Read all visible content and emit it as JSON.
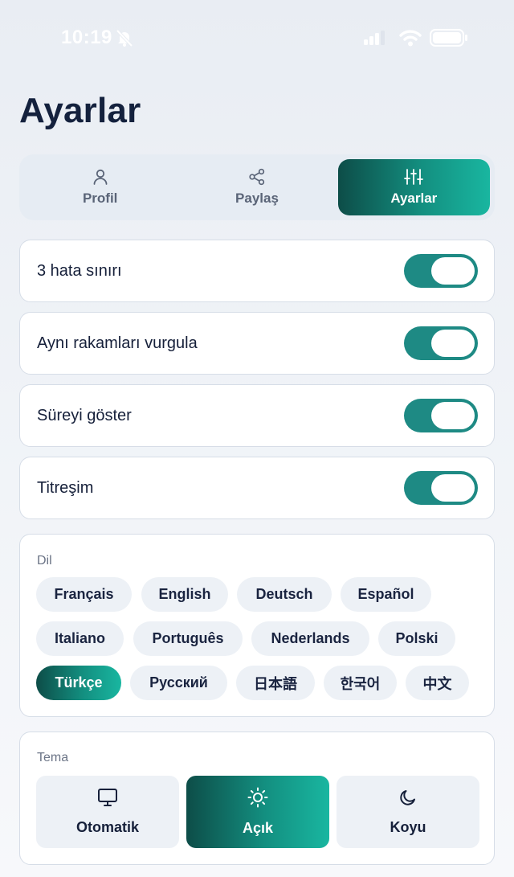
{
  "status_bar": {
    "time": "10:19"
  },
  "page": {
    "title": "Ayarlar"
  },
  "tabs": [
    {
      "label": "Profil",
      "icon": "user-icon",
      "active": false
    },
    {
      "label": "Paylaş",
      "icon": "share-icon",
      "active": false
    },
    {
      "label": "Ayarlar",
      "icon": "sliders-icon",
      "active": true
    }
  ],
  "toggles": [
    {
      "label": "3 hata sınırı",
      "on": true
    },
    {
      "label": "Aynı rakamları vurgula",
      "on": true
    },
    {
      "label": "Süreyi göster",
      "on": true
    },
    {
      "label": "Titreşim",
      "on": true
    }
  ],
  "language": {
    "label": "Dil",
    "selected": "Türkçe",
    "options": [
      "Français",
      "English",
      "Deutsch",
      "Español",
      "Italiano",
      "Português",
      "Nederlands",
      "Polski",
      "Türkçe",
      "Русский",
      "日本語",
      "한국어",
      "中文"
    ]
  },
  "theme": {
    "label": "Tema",
    "selected": "Açık",
    "options": [
      {
        "label": "Otomatik",
        "icon": "monitor-icon"
      },
      {
        "label": "Açık",
        "icon": "sun-icon"
      },
      {
        "label": "Koyu",
        "icon": "moon-icon"
      }
    ]
  },
  "colors": {
    "accent_start": "#0d4d48",
    "accent_end": "#19b6a0",
    "switch_on": "#1e8a84",
    "title": "#14213d"
  }
}
